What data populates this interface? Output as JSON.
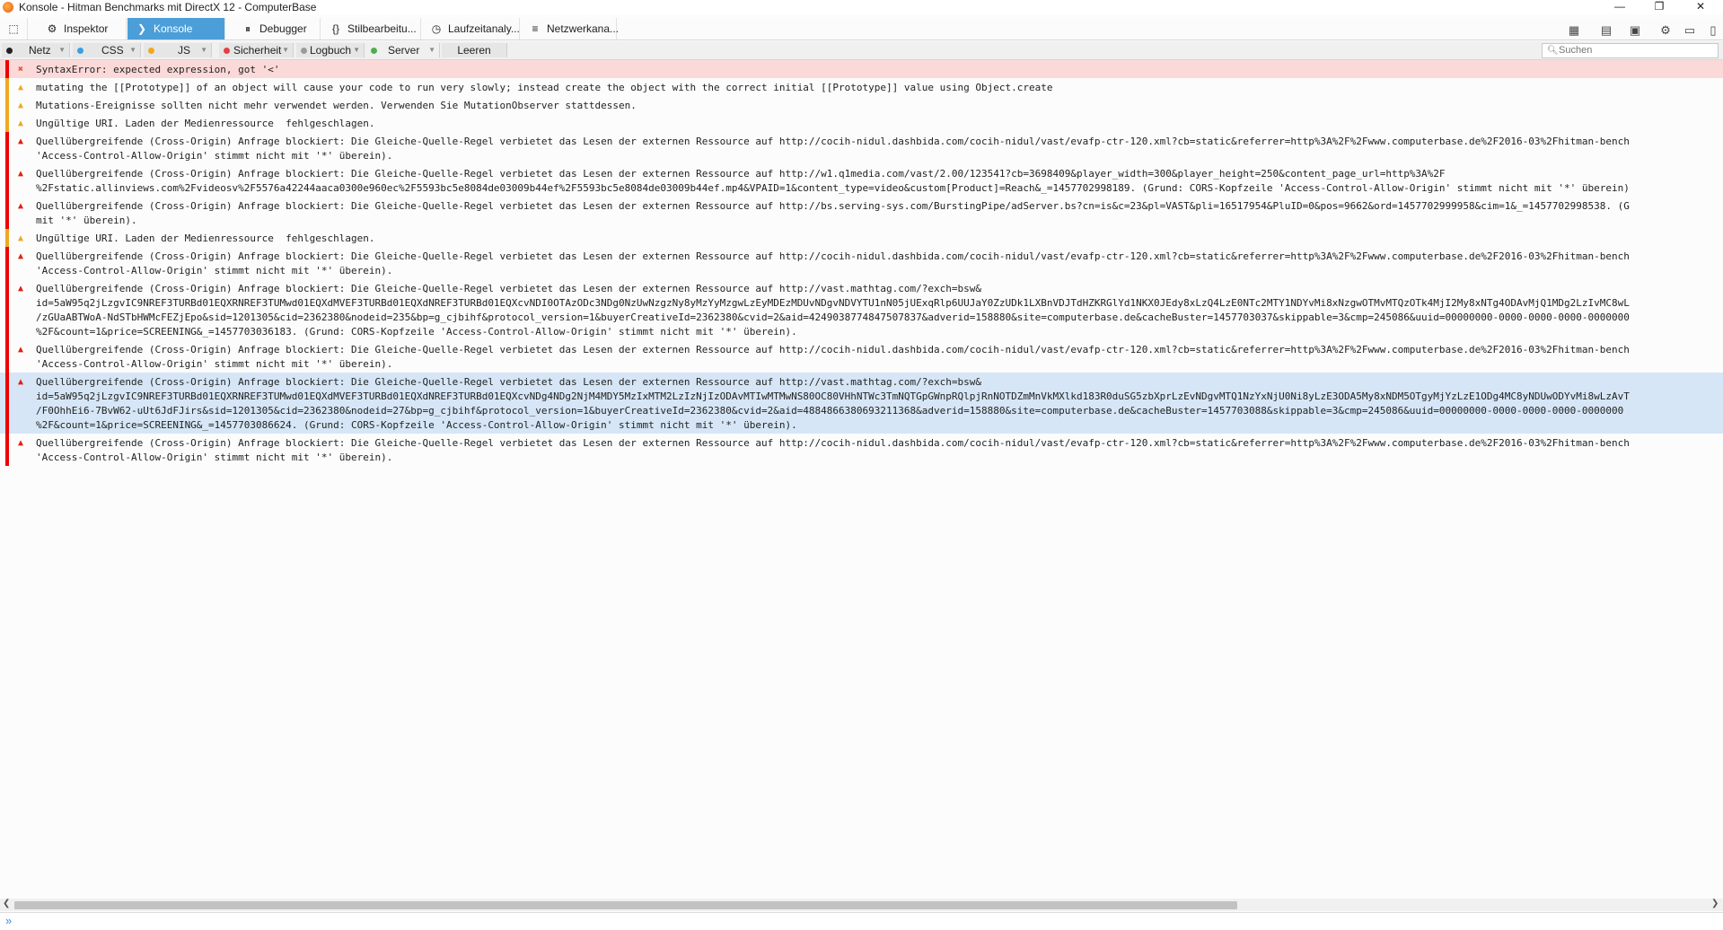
{
  "window": {
    "title": "Konsole - Hitman Benchmarks mit DirectX 12 - ComputerBase",
    "minimize": "—",
    "maximize": "❐",
    "close": "✕"
  },
  "tabs": [
    {
      "label": "Inspektor",
      "icon": "inspector-icon"
    },
    {
      "label": "Konsole",
      "icon": "console-icon"
    },
    {
      "label": "Debugger",
      "icon": "debugger-icon"
    },
    {
      "label": "Stilbearbeitu...",
      "icon": "style-editor-icon"
    },
    {
      "label": "Laufzeitanaly...",
      "icon": "performance-icon"
    },
    {
      "label": "Netzwerkana...",
      "icon": "network-icon"
    }
  ],
  "filters": [
    {
      "label": "Netz",
      "color": "#222222"
    },
    {
      "label": "CSS",
      "color": "#3a9ee6"
    },
    {
      "label": "JS",
      "color": "#f0a821"
    },
    {
      "label": "Sicherheit",
      "color": "#e34040"
    },
    {
      "label": "Logbuch",
      "color": "#9a9a9a"
    },
    {
      "label": "Server",
      "color": "#4caf50"
    }
  ],
  "clear_label": "Leeren",
  "search": {
    "placeholder": "Suchen",
    "value": ""
  },
  "messages": [
    {
      "severity": "jserr",
      "lines": [
        "SyntaxError: expected expression, got '<'"
      ]
    },
    {
      "severity": "warn",
      "lines": [
        "mutating the [[Prototype]] of an object will cause your code to run very slowly; instead create the object with the correct initial [[Prototype]] value using Object.create"
      ]
    },
    {
      "severity": "warn",
      "lines": [
        "Mutations-Ereignisse sollten nicht mehr verwendet werden. Verwenden Sie MutationObserver stattdessen."
      ]
    },
    {
      "severity": "warn",
      "lines": [
        "Ungültige URI. Laden der Medienressource  fehlgeschlagen."
      ]
    },
    {
      "severity": "error",
      "lines": [
        "Quellübergreifende (Cross-Origin) Anfrage blockiert: Die Gleiche-Quelle-Regel verbietet das Lesen der externen Ressource auf http://cocih-nidul.dashbida.com/cocih-nidul/vast/evafp-ctr-120.xml?cb=static&referrer=http%3A%2F%2Fwww.computerbase.de%2F2016-03%2Fhitman-bench",
        "'Access-Control-Allow-Origin' stimmt nicht mit '*' überein)."
      ]
    },
    {
      "severity": "error",
      "lines": [
        "Quellübergreifende (Cross-Origin) Anfrage blockiert: Die Gleiche-Quelle-Regel verbietet das Lesen der externen Ressource auf http://w1.q1media.com/vast/2.00/123541?cb=3698409&player_width=300&player_height=250&content_page_url=http%3A%2F",
        "%2Fstatic.allinviews.com%2Fvideosv%2F5576a42244aaca0300e960ec%2F5593bc5e8084de03009b44ef%2F5593bc5e8084de03009b44ef.mp4&VPAID=1&content_type=video&custom[Product]=Reach&_=1457702998189. (Grund: CORS-Kopfzeile 'Access-Control-Allow-Origin' stimmt nicht mit '*' überein)"
      ]
    },
    {
      "severity": "error",
      "lines": [
        "Quellübergreifende (Cross-Origin) Anfrage blockiert: Die Gleiche-Quelle-Regel verbietet das Lesen der externen Ressource auf http://bs.serving-sys.com/BurstingPipe/adServer.bs?cn=is&c=23&pl=VAST&pli=16517954&PluID=0&pos=9662&ord=1457702999958&cim=1&_=1457702998538. (G",
        "mit '*' überein)."
      ]
    },
    {
      "severity": "warn",
      "lines": [
        "Ungültige URI. Laden der Medienressource  fehlgeschlagen."
      ]
    },
    {
      "severity": "error",
      "lines": [
        "Quellübergreifende (Cross-Origin) Anfrage blockiert: Die Gleiche-Quelle-Regel verbietet das Lesen der externen Ressource auf http://cocih-nidul.dashbida.com/cocih-nidul/vast/evafp-ctr-120.xml?cb=static&referrer=http%3A%2F%2Fwww.computerbase.de%2F2016-03%2Fhitman-bench",
        "'Access-Control-Allow-Origin' stimmt nicht mit '*' überein)."
      ]
    },
    {
      "severity": "error",
      "lines": [
        "Quellübergreifende (Cross-Origin) Anfrage blockiert: Die Gleiche-Quelle-Regel verbietet das Lesen der externen Ressource auf http://vast.mathtag.com/?exch=bsw&",
        "id=5aW95q2jLzgvIC9NREF3TURBd01EQXRNREF3TUMwd01EQXdMVEF3TURBd01EQXdNREF3TURBd01EQXcvNDI0OTAzODc3NDg0NzUwNzgzNy8yMzYyMzgwLzEyMDEzMDUvNDgvNDVYTU1nN05jUExqRlp6UUJaY0ZzUDk1LXBnVDJTdHZKRGlYd1NKX0JEdy8xLzQ4LzE0NTc2MTY1NDYvMi8xNzgwOTMvMTQzOTk4MjI2My8xNTg4ODAvMjQ1MDg2LzIvMC8wL",
        "/zGUaABTWoA-NdSTbHWMcFEZjEpo&sid=1201305&cid=2362380&nodeid=235&bp=g_cjbihf&protocol_version=1&buyerCreativeId=2362380&cvid=2&aid=4249038774847507837&adverid=158880&site=computerbase.de&cacheBuster=1457703037&skippable=3&cmp=245086&uuid=00000000-0000-0000-0000-0000000",
        "%2F&count=1&price=SCREENING&_=1457703036183. (Grund: CORS-Kopfzeile 'Access-Control-Allow-Origin' stimmt nicht mit '*' überein)."
      ]
    },
    {
      "severity": "error",
      "lines": [
        "Quellübergreifende (Cross-Origin) Anfrage blockiert: Die Gleiche-Quelle-Regel verbietet das Lesen der externen Ressource auf http://cocih-nidul.dashbida.com/cocih-nidul/vast/evafp-ctr-120.xml?cb=static&referrer=http%3A%2F%2Fwww.computerbase.de%2F2016-03%2Fhitman-bench",
        "'Access-Control-Allow-Origin' stimmt nicht mit '*' überein)."
      ]
    },
    {
      "severity": "error",
      "selected": true,
      "lines": [
        "Quellübergreifende (Cross-Origin) Anfrage blockiert: Die Gleiche-Quelle-Regel verbietet das Lesen der externen Ressource auf http://vast.mathtag.com/?exch=bsw&",
        "id=5aW95q2jLzgvIC9NREF3TURBd01EQXRNREF3TUMwd01EQXdMVEF3TURBd01EQXdNREF3TURBd01EQXcvNDg4NDg2NjM4MDY5MzIxMTM2LzIzNjIzODAvMTIwMTMwNS80OC80VHhNTWc3TmNQTGpGWnpRQlpjRnNOTDZmMnVkMXlkd183R0duSG5zbXprLzEvNDgvMTQ1NzYxNjU0Ni8yLzE3ODA5My8xNDM5OTgyMjYzLzE1ODg4MC8yNDUwODYvMi8wLzAvT",
        "/F0OhhEi6-7BvW62-uUt6JdFJirs&sid=1201305&cid=2362380&nodeid=27&bp=g_cjbihf&protocol_version=1&buyerCreativeId=2362380&cvid=2&aid=4884866380693211368&adverid=158880&site=computerbase.de&cacheBuster=1457703088&skippable=3&cmp=245086&uuid=00000000-0000-0000-0000-0000000",
        "%2F&count=1&price=SCREENING&_=1457703086624. (Grund: CORS-Kopfzeile 'Access-Control-Allow-Origin' stimmt nicht mit '*' überein)."
      ]
    },
    {
      "severity": "error",
      "lines": [
        "Quellübergreifende (Cross-Origin) Anfrage blockiert: Die Gleiche-Quelle-Regel verbietet das Lesen der externen Ressource auf http://cocih-nidul.dashbida.com/cocih-nidul/vast/evafp-ctr-120.xml?cb=static&referrer=http%3A%2F%2Fwww.computerbase.de%2F2016-03%2Fhitman-bench",
        "'Access-Control-Allow-Origin' stimmt nicht mit '*' überein)."
      ]
    }
  ],
  "console_input": {
    "value": ""
  }
}
